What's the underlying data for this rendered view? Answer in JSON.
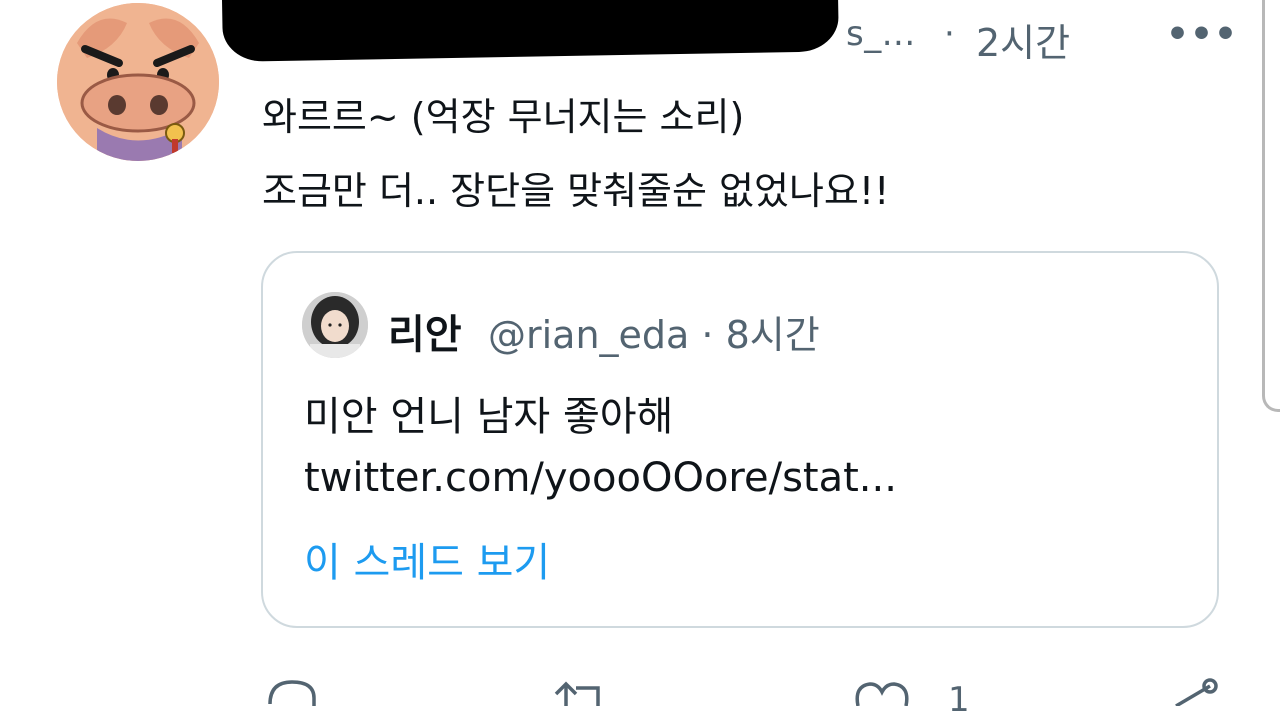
{
  "tweet": {
    "handle_suffix": "s_...",
    "dot": "·",
    "time": "2시간",
    "more_glyph": "•••",
    "lines": [
      "와르르~ (억장 무너지는 소리)",
      "조금만 더.. 장단을 맞춰줄순 없었나요!!"
    ]
  },
  "quote": {
    "name": "리안",
    "handle_time": "@rian_eda · 8시간",
    "text": "미안 언니 남자 좋아해",
    "link": "twitter.com/yoooOOore/stat...",
    "thread_link": "이 스레드 보기"
  },
  "actions": {
    "like_count": "1"
  },
  "colors": {
    "link_blue": "#1d9bf0",
    "secondary_text": "#536471",
    "border": "#cfd9de"
  },
  "icons": [
    "reply-icon",
    "retweet-icon",
    "like-icon",
    "share-icon",
    "more-icon"
  ]
}
